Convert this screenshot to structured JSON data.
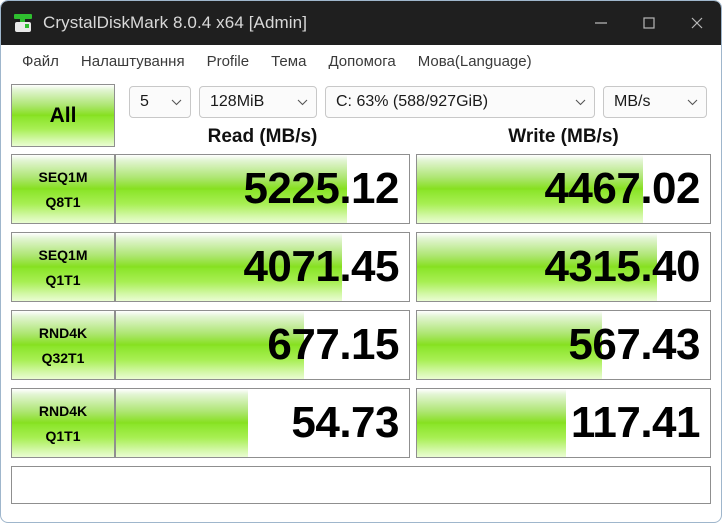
{
  "window": {
    "title": "CrystalDiskMark 8.0.4 x64 [Admin]",
    "icon": "disk-drive-icon",
    "controls": {
      "minimize": "minimize-icon",
      "maximize": "maximize-icon",
      "close": "close-icon"
    }
  },
  "menu": {
    "items": [
      {
        "label": "Файл"
      },
      {
        "label": "Налаштування"
      },
      {
        "label": "Profile"
      },
      {
        "label": "Тема"
      },
      {
        "label": "Допомога"
      },
      {
        "label": "Мова(Language)"
      }
    ]
  },
  "toolbar": {
    "all_button": "All",
    "count": "5",
    "size": "128MiB",
    "drive": "C: 63% (588/927GiB)",
    "unit": "MB/s",
    "chevron": "chevron-down-icon"
  },
  "headers": {
    "read": "Read (MB/s)",
    "write": "Write (MB/s)"
  },
  "colors": {
    "accent_green": "#86e01f",
    "titlebar": "#1f1f1f",
    "border": "#8f8f8f"
  },
  "chart_data": {
    "type": "bar",
    "title": "CrystalDiskMark 8.0.4 x64 benchmark results",
    "xlabel": "",
    "ylabel": "MB/s",
    "categories": [
      "SEQ1M Q8T1",
      "SEQ1M Q1T1",
      "RND4K Q32T1",
      "RND4K Q1T1"
    ],
    "series": [
      {
        "name": "Read (MB/s)",
        "values": [
          5225.12,
          4071.45,
          677.15,
          54.73
        ]
      },
      {
        "name": "Write (MB/s)",
        "values": [
          4467.02,
          4315.4,
          567.43,
          117.41
        ]
      }
    ],
    "legend_position": "top",
    "grid": false
  },
  "rows": [
    {
      "label_line1": "SEQ1M",
      "label_line2": "Q8T1",
      "read": "5225.12",
      "write": "4467.02",
      "read_fill": "79%",
      "write_fill": "77%"
    },
    {
      "label_line1": "SEQ1M",
      "label_line2": "Q1T1",
      "read": "4071.45",
      "write": "4315.40",
      "read_fill": "77%",
      "write_fill": "82%"
    },
    {
      "label_line1": "RND4K",
      "label_line2": "Q32T1",
      "read": "677.15",
      "write": "567.43",
      "read_fill": "64%",
      "write_fill": "63%"
    },
    {
      "label_line1": "RND4K",
      "label_line2": "Q1T1",
      "read": "54.73",
      "write": "117.41",
      "read_fill": "45%",
      "write_fill": "51%"
    }
  ],
  "comment": {
    "value": ""
  }
}
